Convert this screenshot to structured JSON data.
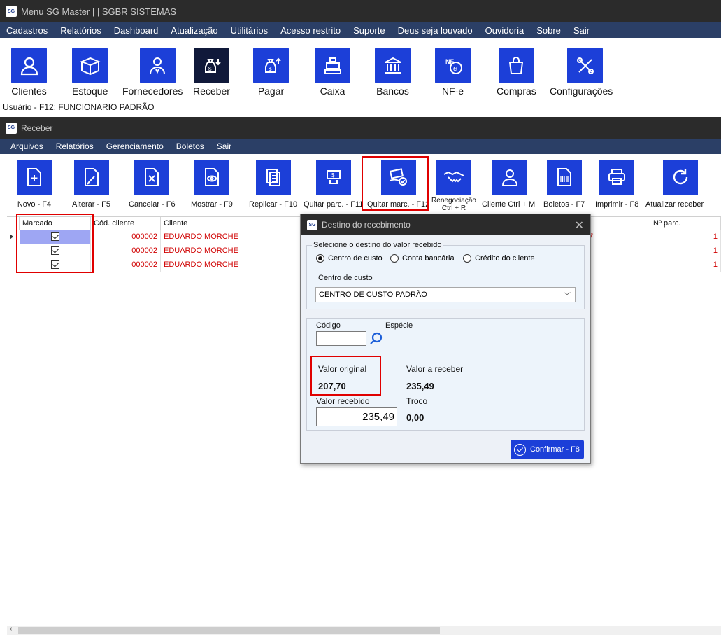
{
  "main_window": {
    "title": "Menu SG Master | | SGBR SISTEMAS",
    "logo": "SG",
    "menu": [
      "Cadastros",
      "Relatórios",
      "Dashboard",
      "Atualização",
      "Utilitários",
      "Acesso restrito",
      "Suporte",
      "Deus seja louvado",
      "Ouvidoria",
      "Sobre",
      "Sair"
    ],
    "toolbar": [
      {
        "label": "Clientes",
        "icon": "user-icon"
      },
      {
        "label": "Estoque",
        "icon": "box-icon"
      },
      {
        "label": "Fornecedores",
        "icon": "supplier-icon"
      },
      {
        "label": "Receber",
        "icon": "money-bag-in-icon"
      },
      {
        "label": "Pagar",
        "icon": "money-bag-out-icon"
      },
      {
        "label": "Caixa",
        "icon": "cash-register-icon"
      },
      {
        "label": "Bancos",
        "icon": "bank-icon"
      },
      {
        "label": "NF-e",
        "icon": "nfe-icon"
      },
      {
        "label": "Compras",
        "icon": "shopping-bag-icon"
      },
      {
        "label": "Configurações",
        "icon": "tools-icon"
      }
    ],
    "user_line": "Usuário - F12:  FUNCIONARIO PADRÃO"
  },
  "receber_window": {
    "title": "Receber",
    "logo": "SG",
    "menu": [
      "Arquivos",
      "Relatórios",
      "Gerenciamento",
      "Boletos",
      "Sair"
    ],
    "toolbar": [
      {
        "label": "Novo - F4",
        "icon": "new-doc-icon"
      },
      {
        "label": "Alterar - F5",
        "icon": "edit-doc-icon"
      },
      {
        "label": "Cancelar - F6",
        "icon": "cancel-doc-icon"
      },
      {
        "label": "Mostrar - F9",
        "icon": "view-doc-icon"
      },
      {
        "label": "Replicar - F10",
        "icon": "copy-doc-icon"
      },
      {
        "label": "Quitar parc. - F11",
        "icon": "pay-installment-icon"
      },
      {
        "label": "Quitar marc. - F12",
        "icon": "pay-marked-icon"
      },
      {
        "label": "Renegociação Ctrl + R",
        "icon": "handshake-icon"
      },
      {
        "label": "Cliente Ctrl + M",
        "icon": "client-icon"
      },
      {
        "label": "Boletos - F7",
        "icon": "barcode-icon"
      },
      {
        "label": "Imprimir - F8",
        "icon": "printer-icon"
      },
      {
        "label": "Atualizar receber",
        "icon": "refresh-icon"
      }
    ],
    "grid": {
      "columns": [
        "Marcado",
        "Cód. cliente",
        "Cliente",
        "Nº parc."
      ],
      "rows": [
        {
          "marcado": true,
          "cod": "000002",
          "cliente": "EDUARDO MORCHE",
          "parc": "1"
        },
        {
          "marcado": true,
          "cod": "000002",
          "cliente": "EDUARDO MORCHE",
          "parc": "1"
        },
        {
          "marcado": true,
          "cod": "000002",
          "cliente": "EDUARDO MORCHE",
          "parc": "1"
        }
      ],
      "hidden_cell": "7"
    }
  },
  "dialog": {
    "title": "Destino do recebimento",
    "logo": "SG",
    "destino_label": "Selecione o destino do valor recebido",
    "options": [
      "Centro de custo",
      "Conta bancária",
      "Crédito do cliente"
    ],
    "selected_option": "Centro de custo",
    "centro_label": "Centro de custo",
    "centro_value": "CENTRO DE CUSTO PADRÃO",
    "codigo_label": "Código",
    "codigo_value": "",
    "especie_label": "Espécie",
    "valor_original_label": "Valor original",
    "valor_original": "207,70",
    "valor_receber_label": "Valor a receber",
    "valor_receber": "235,49",
    "valor_recebido_label": "Valor recebido",
    "valor_recebido": "235,49",
    "troco_label": "Troco",
    "troco": "0,00",
    "confirm_label": "Confirmar - F8"
  }
}
